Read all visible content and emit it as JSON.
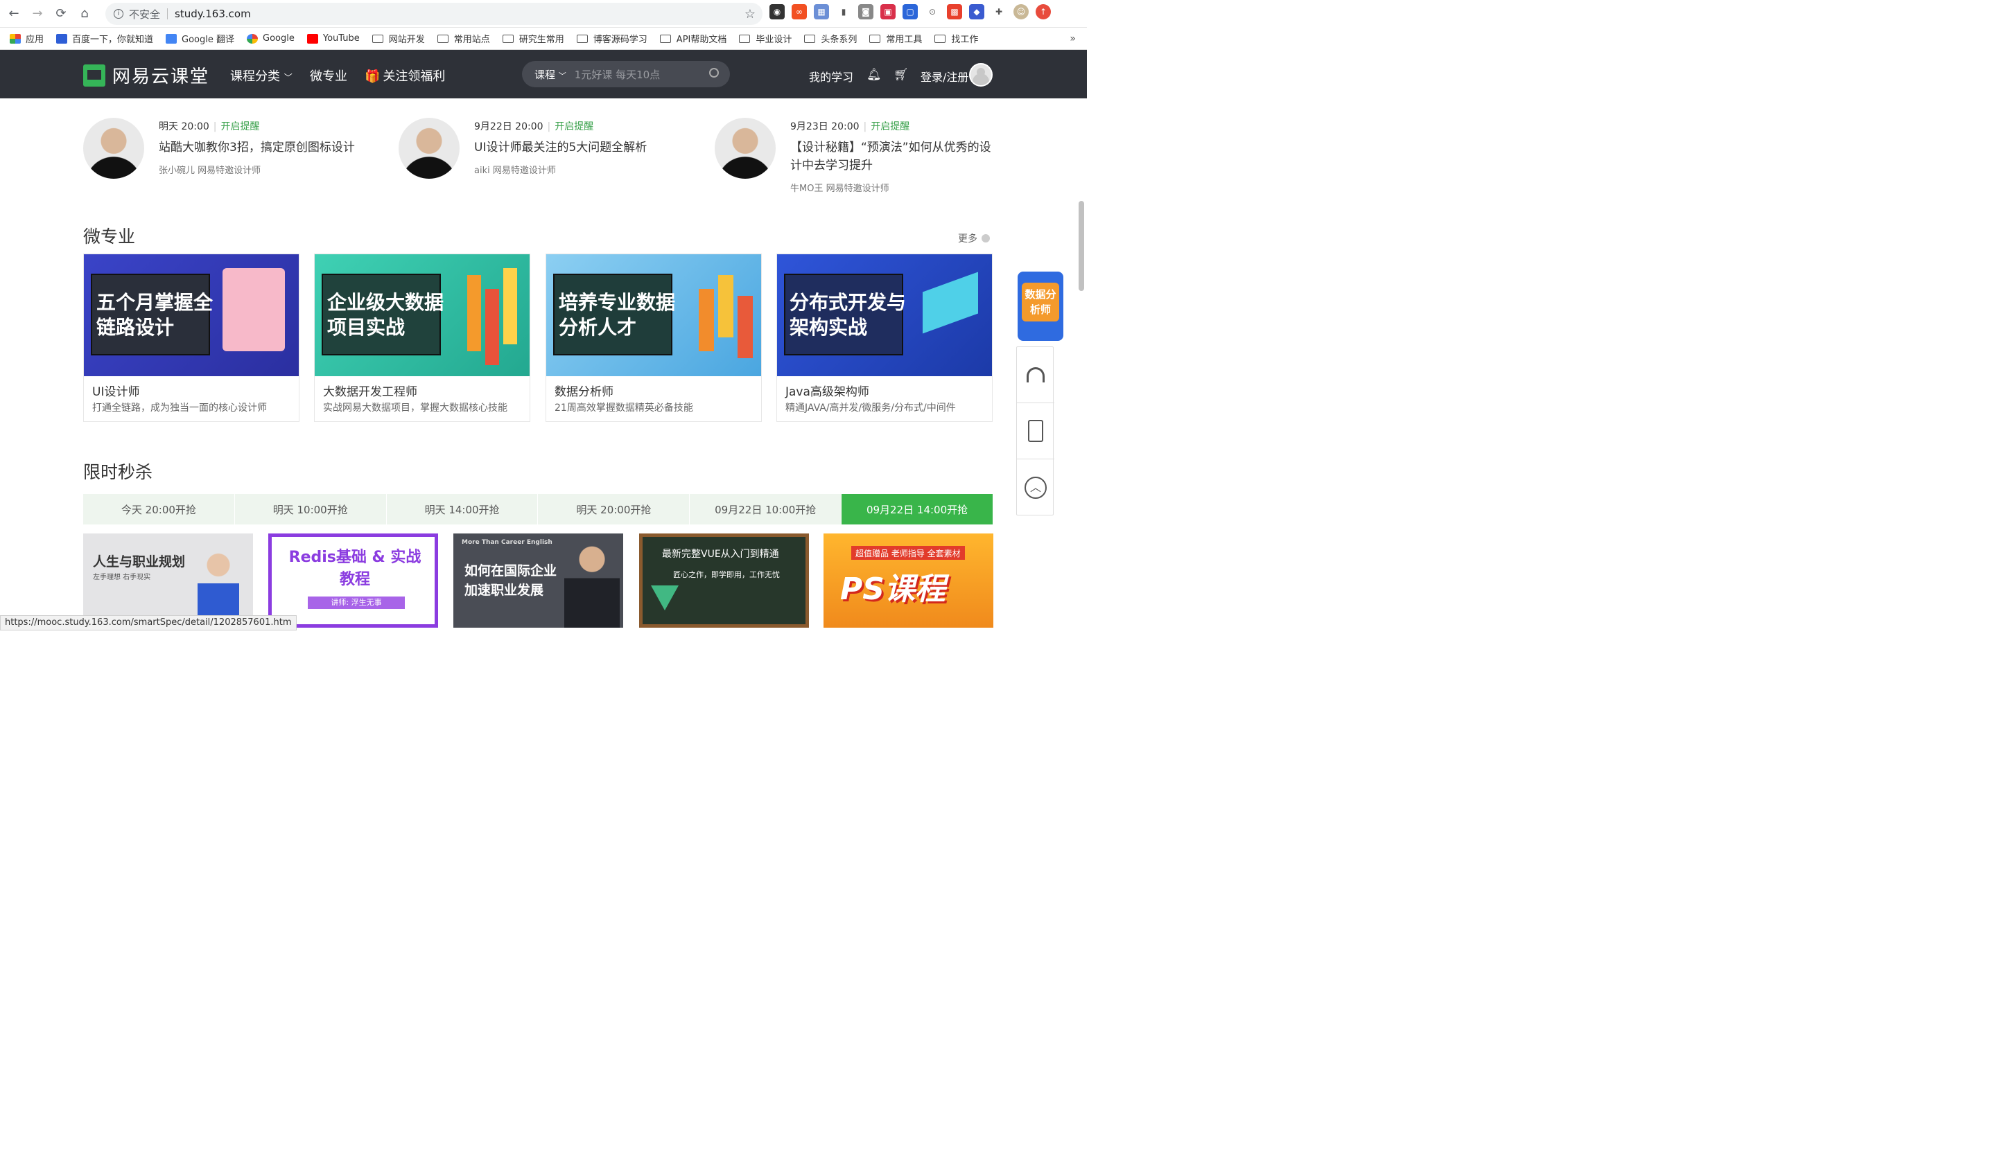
{
  "browser": {
    "security_label": "不安全",
    "url": "study.163.com",
    "bookmarks": [
      "应用",
      "百度一下，你就知道",
      "Google 翻译",
      "Google",
      "YouTube",
      "网站开发",
      "常用站点",
      "研究生常用",
      "博客源码学习",
      "API帮助文档",
      "毕业设计",
      "头条系列",
      "常用工具",
      "找工作"
    ],
    "more": "»",
    "status_url": "https://mooc.study.163.com/smartSpec/detail/1202857601.htm"
  },
  "header": {
    "logo_text": "网易云课堂",
    "nav": [
      "课程分类",
      "微专业",
      "关注领福利"
    ],
    "search_category": "课程",
    "search_placeholder": "1元好课 每天10点",
    "my_learning": "我的学习",
    "login": "登录/注册"
  },
  "lives": [
    {
      "time": "明天 20:00",
      "remind": "开启提醒",
      "title": "站酷大咖教你3招，搞定原创图标设计",
      "speaker": "张小碗儿 网易特邀设计师"
    },
    {
      "time": "9月22日 20:00",
      "remind": "开启提醒",
      "title": "UI设计师最关注的5大问题全解析",
      "speaker": "aiki 网易特邀设计师"
    },
    {
      "time": "9月23日 20:00",
      "remind": "开启提醒",
      "title": "【设计秘籍】“预演法”如何从优秀的设计中去学习提升",
      "speaker": "牛MO王 网易特邀设计师"
    }
  ],
  "micro": {
    "title": "微专业",
    "more": "更多",
    "cards": [
      {
        "banner_text": "五个月掌握全链路设计",
        "name": "UI设计师",
        "desc": "打通全链路，成为独当一面的核心设计师",
        "color": "#3d46c9"
      },
      {
        "banner_text": "企业级大数据项目实战",
        "name": "大数据开发工程师",
        "desc": "实战网易大数据项目，掌握大数据核心技能",
        "color": "#2fc3a6"
      },
      {
        "banner_text": "培养专业数据分析人才",
        "name": "数据分析师",
        "desc": "21周高效掌握数据精英必备技能",
        "color": "#5fb7e8"
      },
      {
        "banner_text": "分布式开发与架构实战",
        "name": "Java高级架构师",
        "desc": "精通JAVA/高并发/微服务/分布式/中间件",
        "color": "#2f54d6"
      }
    ]
  },
  "flash": {
    "title": "限时秒杀",
    "tabs": [
      "今天  20:00开抢",
      "明天  10:00开抢",
      "明天  14:00开抢",
      "明天  20:00开抢",
      "09月22日  10:00开抢",
      "09月22日  14:00开抢"
    ],
    "active_tab": 5,
    "courses": [
      {
        "title": "人生与职业规划",
        "sub": "左手理想 右手现实"
      },
      {
        "title": "Redis基础 & 实战教程",
        "sub": "讲师: 浮生无事"
      },
      {
        "title": "如何在国际企业加速职业发展",
        "sub": "More Than Career English"
      },
      {
        "title": "最新完整VUE从入门到精通",
        "sub": "匠心之作，即学即用，工作无忧"
      },
      {
        "title": "PS课程",
        "sub": "超值赠品 老师指导 全套素材"
      }
    ]
  },
  "side": {
    "ad_text": "数据分析师"
  }
}
